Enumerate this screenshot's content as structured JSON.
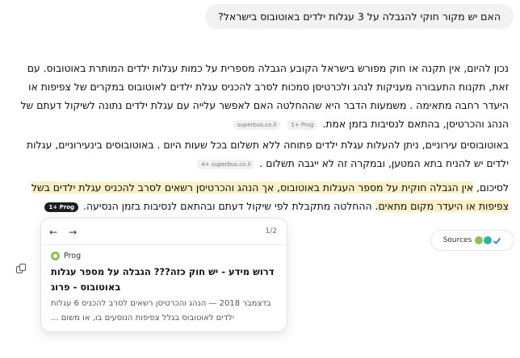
{
  "user_message": "האם יש מקור חוקי להגבלה על 3 עגלות ילדים באוטובוס בישראל?",
  "answer": {
    "p1": {
      "text": "נכון להיום, אין תקנה או חוק מפורש בישראל הקובע הגבלה מספרית על כמות עגלות ילדים המותרת באוטובוס. עם זאת, תקנות התעבורה מעניקות לנהג ולכרטיסן סמכות לסרב להכניס עגלת ילדים לאוטובוס במקרים של צפיפות או היעדר רחבה מתאימה . משמעות הדבר היא שההחלטה האם לאפשר עלייה עם עגלת ילדים נתונה לשיקול דעתם של הנהג והכרטיסן, בהתאם לנסיבות בזמן אמת.",
      "chip_site": "superbus.co.il",
      "chip_count": "1+ Prog"
    },
    "p2": {
      "text": "באוטובוסים עירוניים, ניתן להעלות עגלת ילדים פתוחה ללא תשלום בכל שעות היום . באוטובוסים בינעירוניים, עגלות ילדים יש להניח בתא המטען, ובמקרה זה לא ייגבה תשלום .",
      "chip": "4+ superbus.co.il"
    },
    "p3": {
      "lead": "לסיכום, ",
      "highlight": "אין הגבלה חוקית על מספר העגלות באוטובוס, אך הנהג והכרטיסן רשאים לסרב להכניס עגלת ילדים בשל צפיפות או היעדר מקום מתאים.",
      "rest": " ההחלטה מתקבלת לפי שיקול דעתם ובהתאם לנסיבות בזמן הנסיעה.",
      "chip": "1+ Prog"
    }
  },
  "sources_button": {
    "label": "Sources",
    "icons": [
      "green-bus-logo",
      "superbus-logo",
      "check-icon"
    ],
    "colors": [
      "#8bc34a",
      "#2bb5a5",
      "#3a7bd5"
    ]
  },
  "popup": {
    "pager": "1/2",
    "source_name": "Prog",
    "title": "דרוש מידע - יש חוק כזה??? הגבלה על מספר עגלות באוטובוס - פרוג",
    "snippet": "בדצמבר 2018 — הנהג והכרטיסן רשאים לסרב להכניס 6 עגלות ילדים לאוטובוס בגלל צפיפות הנוסעים בו, או משום ..."
  }
}
